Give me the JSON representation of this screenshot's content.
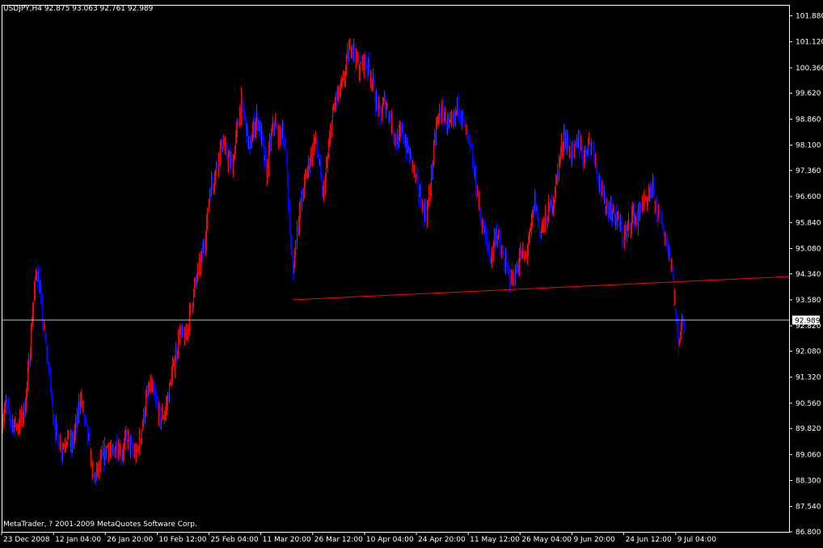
{
  "header": {
    "symbol_info": "USDJPY,H4  92.875 93.063 92.761 92.989"
  },
  "copyright": "MetaTrader, ? 2001-2009 MetaQuotes Software Corp.",
  "colors": {
    "background": "#000000",
    "frame": "#ffffff",
    "bull_bar": "#ff0000",
    "bear_bar": "#0000ff",
    "trendline": "#ff0000",
    "price_line": "#c0c0c0",
    "text": "#ffffff"
  },
  "chart_data": {
    "type": "ohlc",
    "timeframe": "H4",
    "symbol": "USDJPY",
    "last_price": "92.989",
    "ylim": [
      86.8,
      102.2
    ],
    "y_ticks": [
      "101.880",
      "101.120",
      "100.360",
      "99.620",
      "98.860",
      "98.100",
      "97.360",
      "96.600",
      "95.840",
      "95.080",
      "94.340",
      "93.580",
      "92.820",
      "92.080",
      "91.320",
      "90.560",
      "89.820",
      "89.060",
      "88.300",
      "87.540",
      "86.800"
    ],
    "x_ticks": [
      {
        "label": "23 Dec 2008",
        "t": 0
      },
      {
        "label": "12 Jan 04:00",
        "t": 64
      },
      {
        "label": "26 Jan 20:00",
        "t": 128
      },
      {
        "label": "10 Feb 12:00",
        "t": 192
      },
      {
        "label": "25 Feb 04:00",
        "t": 256
      },
      {
        "label": "11 Mar 20:00",
        "t": 320
      },
      {
        "label": "26 Mar 12:00",
        "t": 384
      },
      {
        "label": "10 Apr 04:00",
        "t": 448
      },
      {
        "label": "24 Apr 20:00",
        "t": 512
      },
      {
        "label": "11 May 12:00",
        "t": 576
      },
      {
        "label": "26 May 04:00",
        "t": 640
      },
      {
        "label": "9 Jun 20:00",
        "t": 704
      },
      {
        "label": "24 Jun 12:00",
        "t": 768
      },
      {
        "label": "9 Jul 04:00",
        "t": 832
      }
    ],
    "t_range": [
      0,
      972
    ],
    "price_path": [
      [
        0,
        90.1
      ],
      [
        5,
        90.5
      ],
      [
        12,
        90.0
      ],
      [
        20,
        89.9
      ],
      [
        28,
        90.4
      ],
      [
        33,
        91.6
      ],
      [
        38,
        93.3
      ],
      [
        43,
        94.5
      ],
      [
        47,
        93.8
      ],
      [
        52,
        92.6
      ],
      [
        58,
        91.6
      ],
      [
        63,
        90.3
      ],
      [
        68,
        89.6
      ],
      [
        74,
        89.2
      ],
      [
        80,
        89.6
      ],
      [
        86,
        89.3
      ],
      [
        92,
        89.9
      ],
      [
        97,
        90.8
      ],
      [
        102,
        90.1
      ],
      [
        108,
        89.3
      ],
      [
        113,
        88.3
      ],
      [
        118,
        88.6
      ],
      [
        124,
        88.9
      ],
      [
        130,
        89.3
      ],
      [
        136,
        89.0
      ],
      [
        142,
        89.4
      ],
      [
        148,
        89.1
      ],
      [
        155,
        89.6
      ],
      [
        160,
        89.2
      ],
      [
        166,
        89.0
      ],
      [
        172,
        89.7
      ],
      [
        178,
        90.6
      ],
      [
        184,
        91.1
      ],
      [
        190,
        90.6
      ],
      [
        196,
        90.1
      ],
      [
        202,
        90.3
      ],
      [
        208,
        91.1
      ],
      [
        214,
        91.9
      ],
      [
        220,
        92.6
      ],
      [
        226,
        92.4
      ],
      [
        232,
        93.1
      ],
      [
        238,
        93.9
      ],
      [
        244,
        94.6
      ],
      [
        250,
        95.3
      ],
      [
        256,
        96.8
      ],
      [
        262,
        97.2
      ],
      [
        267,
        97.8
      ],
      [
        272,
        98.2
      ],
      [
        278,
        97.7
      ],
      [
        284,
        97.5
      ],
      [
        290,
        98.6
      ],
      [
        295,
        99.3
      ],
      [
        300,
        98.8
      ],
      [
        305,
        97.9
      ],
      [
        310,
        98.6
      ],
      [
        315,
        98.9
      ],
      [
        320,
        98.3
      ],
      [
        326,
        97.2
      ],
      [
        331,
        98.2
      ],
      [
        336,
        98.8
      ],
      [
        341,
        98.3
      ],
      [
        346,
        98.6
      ],
      [
        351,
        97.6
      ],
      [
        355,
        95.7
      ],
      [
        359,
        94.4
      ],
      [
        363,
        95.5
      ],
      [
        368,
        96.3
      ],
      [
        374,
        97.1
      ],
      [
        380,
        97.7
      ],
      [
        386,
        98.3
      ],
      [
        391,
        97.6
      ],
      [
        396,
        96.6
      ],
      [
        401,
        97.5
      ],
      [
        406,
        98.6
      ],
      [
        411,
        99.4
      ],
      [
        416,
        99.6
      ],
      [
        421,
        99.9
      ],
      [
        426,
        100.6
      ],
      [
        431,
        101.1
      ],
      [
        436,
        100.7
      ],
      [
        441,
        100.3
      ],
      [
        447,
        100.6
      ],
      [
        452,
        100.4
      ],
      [
        457,
        100.0
      ],
      [
        462,
        99.3
      ],
      [
        467,
        98.9
      ],
      [
        472,
        99.4
      ],
      [
        477,
        99.1
      ],
      [
        482,
        98.6
      ],
      [
        488,
        98.2
      ],
      [
        494,
        98.5
      ],
      [
        500,
        98.0
      ],
      [
        506,
        97.6
      ],
      [
        512,
        97.0
      ],
      [
        518,
        96.4
      ],
      [
        524,
        96.0
      ],
      [
        530,
        97.2
      ],
      [
        536,
        98.6
      ],
      [
        541,
        99.1
      ],
      [
        546,
        99.0
      ],
      [
        552,
        98.6
      ],
      [
        557,
        98.7
      ],
      [
        563,
        99.3
      ],
      [
        568,
        98.9
      ],
      [
        574,
        98.4
      ],
      [
        580,
        97.8
      ],
      [
        586,
        96.8
      ],
      [
        592,
        95.9
      ],
      [
        598,
        95.3
      ],
      [
        604,
        94.8
      ],
      [
        610,
        95.6
      ],
      [
        616,
        95.0
      ],
      [
        622,
        94.6
      ],
      [
        628,
        94.2
      ],
      [
        634,
        94.3
      ],
      [
        640,
        94.9
      ],
      [
        646,
        94.8
      ],
      [
        652,
        95.4
      ],
      [
        658,
        96.5
      ],
      [
        664,
        95.6
      ],
      [
        670,
        95.8
      ],
      [
        676,
        96.2
      ],
      [
        682,
        96.6
      ],
      [
        688,
        97.6
      ],
      [
        694,
        98.4
      ],
      [
        700,
        98.0
      ],
      [
        706,
        97.8
      ],
      [
        712,
        98.3
      ],
      [
        718,
        97.7
      ],
      [
        724,
        98.2
      ],
      [
        730,
        98.0
      ],
      [
        736,
        97.1
      ],
      [
        742,
        96.5
      ],
      [
        748,
        96.3
      ],
      [
        754,
        96.1
      ],
      [
        760,
        95.9
      ],
      [
        766,
        95.4
      ],
      [
        772,
        95.6
      ],
      [
        778,
        96.1
      ],
      [
        784,
        95.9
      ],
      [
        790,
        96.5
      ],
      [
        796,
        96.3
      ],
      [
        802,
        96.9
      ],
      [
        808,
        96.2
      ],
      [
        814,
        95.8
      ],
      [
        820,
        95.3
      ],
      [
        826,
        94.7
      ],
      [
        830,
        93.6
      ],
      [
        834,
        92.3
      ],
      [
        838,
        92.8
      ],
      [
        842,
        93.0
      ]
    ],
    "trendline": {
      "color": "#ff0000",
      "points": [
        {
          "t": 359,
          "price": 93.58
        },
        {
          "t": 629,
          "price": 93.88
        },
        {
          "t": 972,
          "price": 94.26
        }
      ]
    },
    "current_price_line": 92.989
  }
}
